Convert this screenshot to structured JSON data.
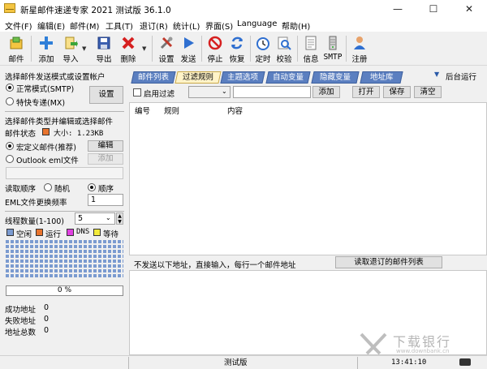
{
  "window": {
    "title": "新星邮件速递专家 2021 测试版 36.1.0",
    "controls": {
      "minimize": "—",
      "maximize": "☐",
      "close": "✕"
    }
  },
  "menu": [
    "文件(F)",
    "编辑(E)",
    "邮件(M)",
    "工具(T)",
    "退订(R)",
    "统计(L)",
    "界面(S)",
    "Language",
    "帮助(H)"
  ],
  "toolbar": {
    "mail": "邮件",
    "add": "添加",
    "import": "导入",
    "export": "导出",
    "delete": "删除",
    "settings": "设置",
    "send": "发送",
    "stop": "停止",
    "resume": "恢复",
    "timer": "定时",
    "verify": "校验",
    "info": "信息",
    "smtp": "SMTP",
    "register": "注册"
  },
  "left": {
    "mode_title": "选择邮件发送模式或设置帐户",
    "mode_normal": "正常模式(SMTP)",
    "mode_express": "特快专递(MX)",
    "settings_button": "设置",
    "type_title": "选择邮件类型并编辑或选择邮件",
    "mail_status_label": "邮件状态",
    "mail_size": "大小: 1.23KB",
    "macro_mail": "宏定义邮件(推荐)",
    "edit_button": "编辑",
    "outlook_eml": "Outlook eml文件",
    "add_button": "添加",
    "read_order_label": "读取顺序",
    "order_random": "随机",
    "order_sequential": "顺序",
    "eml_freq_label": "EML文件更换频率",
    "eml_freq_value": "1",
    "threads_label": "线程数量(1-100)",
    "threads_value": "5",
    "legend": [
      {
        "label": "空闲",
        "color": "#7b9bd0"
      },
      {
        "label": "运行",
        "color": "#e8742e"
      },
      {
        "label": "DNS",
        "color": "#e040e0"
      },
      {
        "label": "等待",
        "color": "#f2ea3a"
      }
    ],
    "progress_text": "0 %",
    "stats": [
      {
        "label": "成功地址",
        "value": "0"
      },
      {
        "label": "失败地址",
        "value": "0"
      },
      {
        "label": "地址总数",
        "value": "0"
      }
    ]
  },
  "right": {
    "tabs": [
      "邮件列表",
      "过滤规则",
      "主题选项",
      "自动变量",
      "隐藏变量",
      "地址库"
    ],
    "active_tab": "过滤规则",
    "background_run": "后台运行",
    "enable_filter": "启用过滤",
    "buttons": {
      "add": "添加",
      "open": "打开",
      "save": "保存",
      "clear": "清空"
    },
    "columns": [
      "编号",
      "规则",
      "内容"
    ],
    "exclude_label": "不发送以下地址，直接输入，每行一个邮件地址",
    "read_unsub_button": "读取退订的邮件列表"
  },
  "status": {
    "mode": "测试版",
    "time": "13:41:10"
  },
  "watermark": {
    "text": "下载银行",
    "url": "www.downbank.cn"
  }
}
